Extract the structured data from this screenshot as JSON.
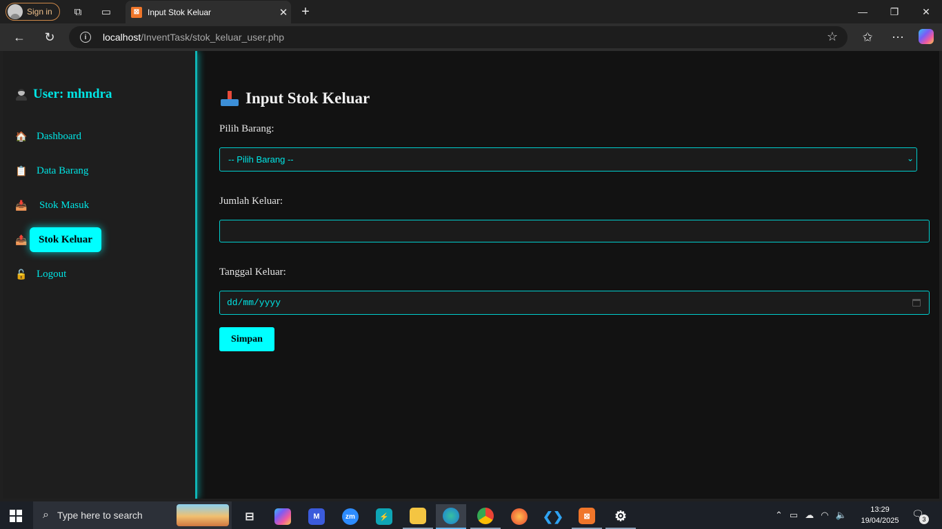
{
  "browser": {
    "sign_in_label": "Sign in",
    "tab_title": "Input Stok Keluar",
    "tab_favicon": "XAMPP",
    "url_host": "localhost",
    "url_path": "/InventTask/stok_keluar_user.php"
  },
  "sidebar": {
    "user_label": "User: mhndra",
    "items": [
      {
        "label": "Dashboard",
        "icon": "house-icon",
        "emoji": "🏠"
      },
      {
        "label": "Data Barang",
        "icon": "clipboard-icon",
        "emoji": "📋"
      },
      {
        "label": "Stok Masuk",
        "icon": "inbox-tray-icon",
        "emoji": "📥"
      },
      {
        "label": "Stok Keluar",
        "icon": "outbox-tray-icon",
        "emoji": "📤",
        "active": true
      },
      {
        "label": "Logout",
        "icon": "lock-icon",
        "emoji": "🔓"
      }
    ]
  },
  "form": {
    "title": "Input Stok Keluar",
    "pilih_barang_label": "Pilih Barang:",
    "pilih_barang_value": "-- Pilih Barang --",
    "jumlah_label": "Jumlah Keluar:",
    "jumlah_value": "",
    "tanggal_label": "Tanggal Keluar:",
    "tanggal_placeholder": "dd/mm/yyyy",
    "submit_label": "Simpan"
  },
  "taskbar": {
    "search_placeholder": "Type here to search",
    "time": "13:29",
    "date": "19/04/2025",
    "notification_count": "3"
  },
  "colors": {
    "accent": "#00ffff",
    "page_bg": "#121212",
    "sidebar_bg": "#1e1e1e"
  }
}
